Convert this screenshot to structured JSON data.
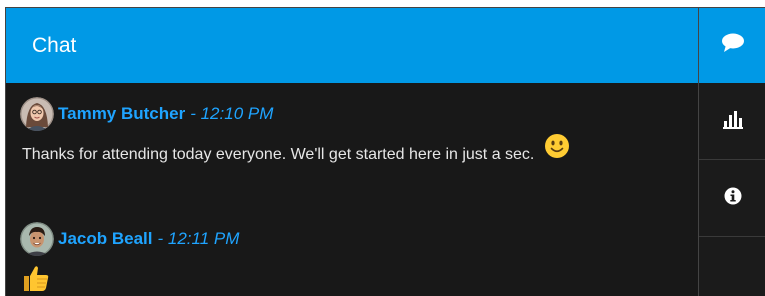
{
  "header": {
    "title": "Chat"
  },
  "messages": [
    {
      "author": "Tammy Butcher",
      "time": "- 12:10 PM",
      "text": "Thanks for attending today everyone.  We'll get started here in just a sec.",
      "emoji_icon": "smiley-face-icon"
    },
    {
      "author": "Jacob Beall",
      "time": "- 12:11 PM",
      "emoji_icon": "thumbs-up-icon"
    }
  ],
  "side_rail": {
    "items": [
      {
        "icon": "chat-bubble-icon",
        "active": true
      },
      {
        "icon": "bar-chart-icon",
        "active": false
      },
      {
        "icon": "info-icon",
        "active": false
      }
    ]
  },
  "colors": {
    "accent": "#0099e6",
    "author": "#1fa4ff",
    "background": "#181818",
    "text": "#e6e6e6"
  }
}
